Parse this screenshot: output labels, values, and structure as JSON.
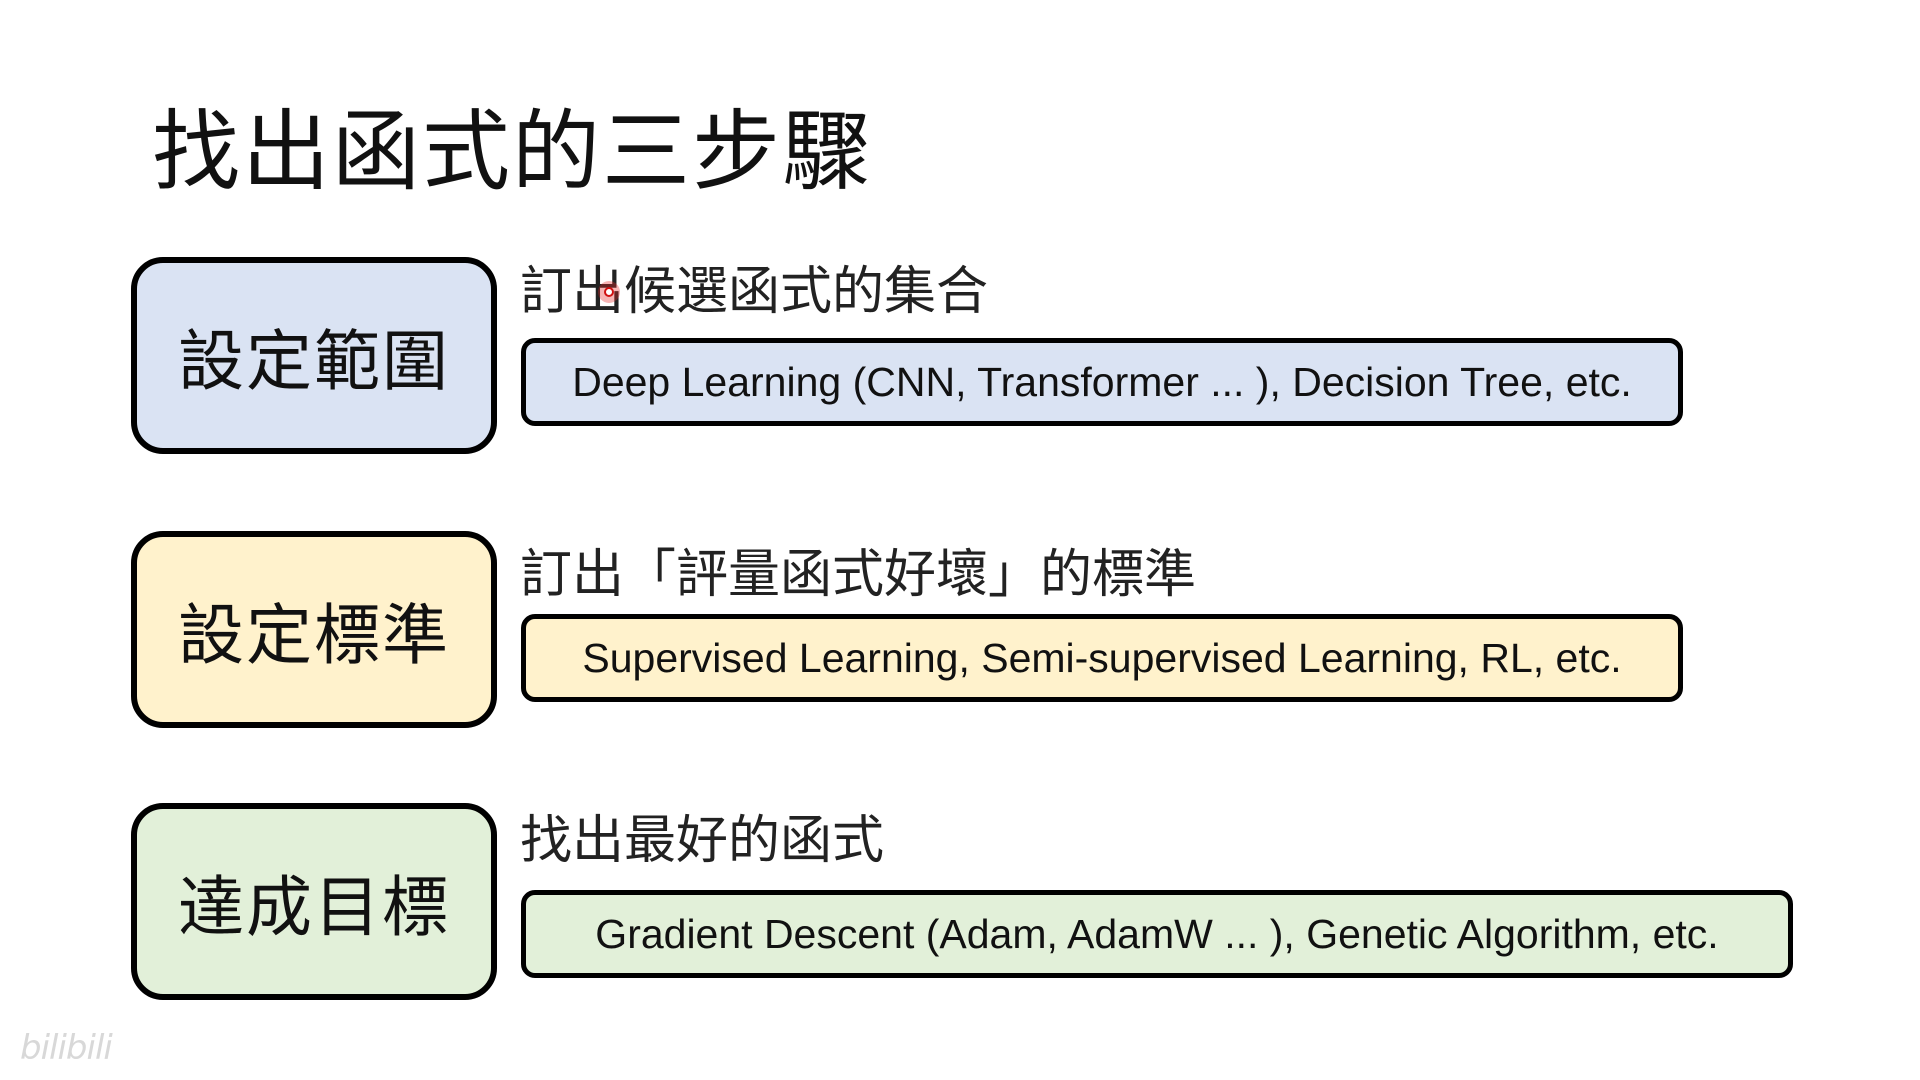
{
  "slide": {
    "title": "找出函式的三步驟",
    "steps": [
      {
        "label": "設定範圍",
        "description": "訂出候選函式的集合",
        "example": "Deep Learning (CNN, Transformer ... ), Decision Tree, etc.",
        "color": "#dae3f3"
      },
      {
        "label": "設定標準",
        "description": "訂出「評量函式好壞」的標準",
        "example": "Supervised Learning, Semi-supervised Learning, RL, etc.",
        "color": "#fff2cc"
      },
      {
        "label": "達成目標",
        "description": "找出最好的函式",
        "example": "Gradient Descent (Adam, AdamW ... ), Genetic Algorithm, etc.",
        "color": "#e2f0d9"
      }
    ]
  },
  "overlay": {
    "cursor_icon": "pointer-dot-icon",
    "cursor_color": "#d01010",
    "watermark": "bilibili"
  }
}
